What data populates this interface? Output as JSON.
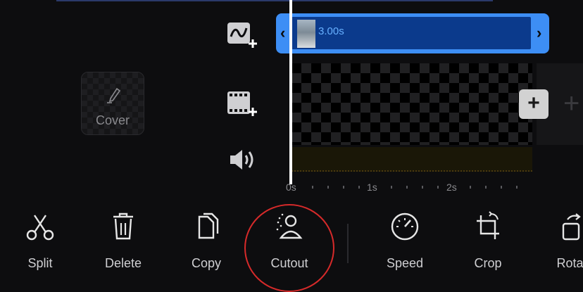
{
  "cover": {
    "label": "Cover",
    "icon": "pen-icon"
  },
  "tracks": {
    "overlay_icon": "add-overlay-icon",
    "video_icon": "add-video-icon",
    "audio_icon": "speaker-icon"
  },
  "clip": {
    "duration": "3.00s",
    "left_handle": "‹",
    "right_handle": "›",
    "color": "#3d8ef5"
  },
  "ruler": {
    "labels": [
      "0s",
      "1s",
      "2s"
    ]
  },
  "add_button": {
    "label": "+"
  },
  "toolbar": {
    "items": [
      {
        "label": "Split",
        "icon": "scissors-icon"
      },
      {
        "label": "Delete",
        "icon": "trash-icon"
      },
      {
        "label": "Copy",
        "icon": "copy-icon"
      },
      {
        "label": "Cutout",
        "icon": "cutout-person-icon",
        "highlighted": true
      },
      {
        "label": "Speed",
        "icon": "speedometer-icon"
      },
      {
        "label": "Crop",
        "icon": "crop-icon"
      },
      {
        "label": "Rotat",
        "icon": "rotate-icon"
      }
    ],
    "highlight_color": "#d62a2a"
  }
}
